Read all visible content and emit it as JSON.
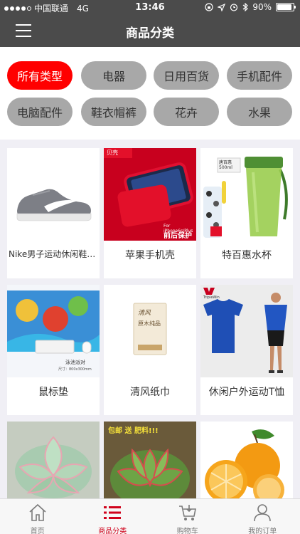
{
  "status_bar": {
    "carrier": "中国联通",
    "network": "4G",
    "time": "13:46",
    "battery": "90%",
    "battery_level": 0.9
  },
  "header": {
    "title": "商品分类"
  },
  "categories": [
    {
      "label": "所有类型",
      "active": true
    },
    {
      "label": "电器",
      "active": false
    },
    {
      "label": "日用百货",
      "active": false
    },
    {
      "label": "手机配件",
      "active": false
    },
    {
      "label": "电脑配件",
      "active": false
    },
    {
      "label": "鞋衣帽裤",
      "active": false
    },
    {
      "label": "花卉",
      "active": false
    },
    {
      "label": "水果",
      "active": false
    }
  ],
  "products": [
    {
      "name": "Nike男子运动休闲鞋8...",
      "image": "sneaker"
    },
    {
      "name": "苹果手机壳",
      "image": "phone-case",
      "img_text": {
        "brand": "贝壳",
        "model": "For iPhone6s/Plus",
        "tag": "前后保护"
      }
    },
    {
      "name": "特百惠水杯",
      "image": "water-bottle",
      "img_text": {
        "brand": "唐百惠",
        "volume": "500ml"
      }
    },
    {
      "name": "鼠标垫",
      "image": "mouse-pad",
      "img_text": {
        "title": "泳池派对",
        "size": "尺寸：800x300mm"
      }
    },
    {
      "name": "清风纸巾",
      "image": "tissue",
      "img_text": {
        "brand": "清风",
        "label": "原木纯品"
      }
    },
    {
      "name": "休闲户外运动T恤",
      "image": "tshirt",
      "img_text": {
        "brand": "TripleWin"
      }
    },
    {
      "name": "",
      "image": "succulent"
    },
    {
      "name": "",
      "image": "succulent-pot",
      "img_text": {
        "banner": "包邮 送 肥料!!!"
      }
    },
    {
      "name": "",
      "image": "orange"
    }
  ],
  "tabbar": [
    {
      "label": "首页",
      "icon": "home-icon",
      "active": false
    },
    {
      "label": "商品分类",
      "icon": "list-icon",
      "active": true
    },
    {
      "label": "购物车",
      "icon": "cart-icon",
      "active": false
    },
    {
      "label": "我的订单",
      "icon": "user-icon",
      "active": false
    }
  ],
  "colors": {
    "header_bg": "#4b4b4b",
    "accent": "#ff0000",
    "chip_bg": "#a8a8a8",
    "tab_active": "#d0021b"
  }
}
